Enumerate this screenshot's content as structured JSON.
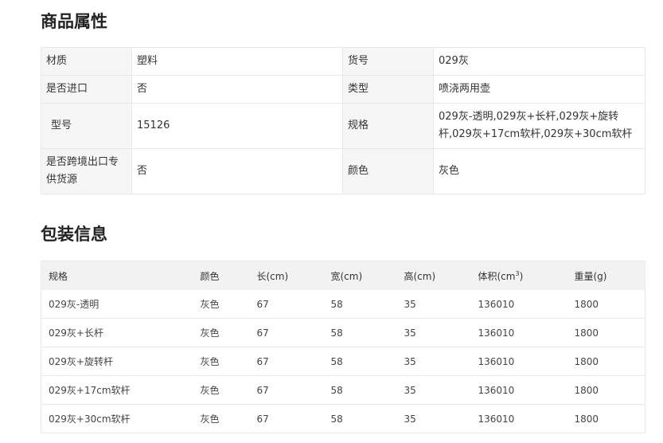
{
  "sections": {
    "attributes_title": "商品属性",
    "packaging_title": "包装信息"
  },
  "attributes": [
    {
      "k1": "材质",
      "v1": "塑料",
      "k2": "货号",
      "v2": "029灰"
    },
    {
      "k1": "是否进口",
      "v1": "否",
      "k2": "类型",
      "v2": "喷浇两用壶"
    },
    {
      "k1": "型号",
      "v1": "15126",
      "k2": "规格",
      "v2": "029灰-透明,029灰+长杆,029灰+旋转杆,029灰+17cm软杆,029灰+30cm软杆"
    },
    {
      "k1": "是否跨境出口专供货源",
      "v1": "否",
      "k2": "颜色",
      "v2": "灰色"
    }
  ],
  "packaging": {
    "headers": {
      "spec": "规格",
      "color": "颜色",
      "length": "长(cm)",
      "width": "宽(cm)",
      "height": "高(cm)",
      "volume": "体积(cm",
      "volume_sup": "3",
      "volume_close": ")",
      "weight": "重量(g)"
    },
    "rows": [
      {
        "spec": "029灰-透明",
        "color": "灰色",
        "length": "67",
        "width": "58",
        "height": "35",
        "volume": "136010",
        "weight": "1800"
      },
      {
        "spec": "029灰+长杆",
        "color": "灰色",
        "length": "67",
        "width": "58",
        "height": "35",
        "volume": "136010",
        "weight": "1800"
      },
      {
        "spec": "029灰+旋转杆",
        "color": "灰色",
        "length": "67",
        "width": "58",
        "height": "35",
        "volume": "136010",
        "weight": "1800"
      },
      {
        "spec": "029灰+17cm软杆",
        "color": "灰色",
        "length": "67",
        "width": "58",
        "height": "35",
        "volume": "136010",
        "weight": "1800"
      },
      {
        "spec": "029灰+30cm软杆",
        "color": "灰色",
        "length": "67",
        "width": "58",
        "height": "35",
        "volume": "136010",
        "weight": "1800"
      }
    ]
  }
}
